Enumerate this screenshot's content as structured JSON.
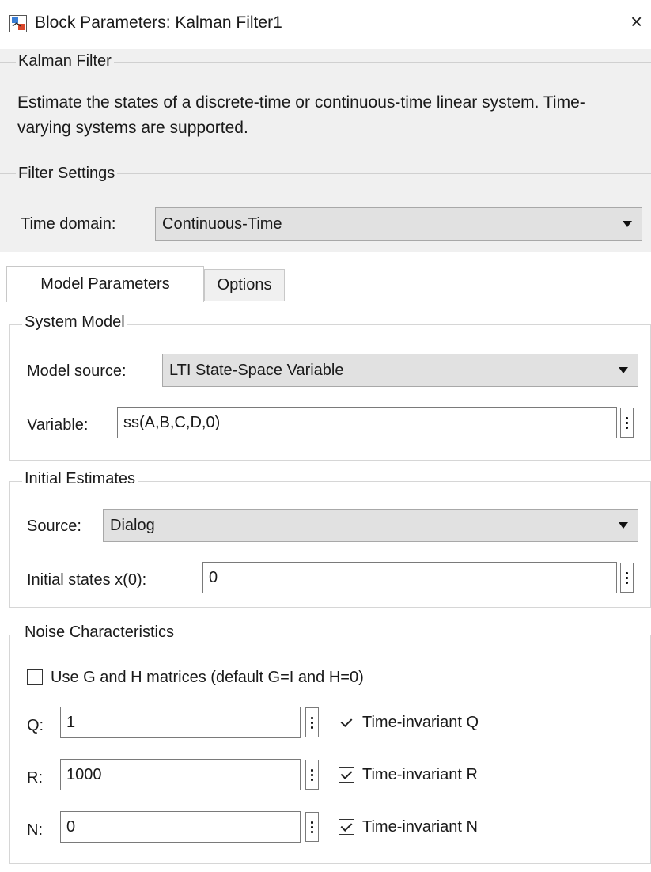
{
  "window": {
    "title": "Block Parameters: Kalman Filter1",
    "close_glyph": "×"
  },
  "block": {
    "name": "Kalman Filter",
    "description": "Estimate the states of a discrete-time or continuous-time linear system. Time-varying systems are supported."
  },
  "filter_settings": {
    "label": "Filter Settings",
    "time_domain_label": "Time domain:",
    "time_domain_value": "Continuous-Time"
  },
  "tabs": [
    {
      "label": "Model Parameters",
      "active": true
    },
    {
      "label": "Options",
      "active": false
    }
  ],
  "system_model": {
    "label": "System Model",
    "model_source_label": "Model source:",
    "model_source_value": "LTI State-Space Variable",
    "variable_label": "Variable:",
    "variable_value": "ss(A,B,C,D,0)"
  },
  "initial_estimates": {
    "label": "Initial Estimates",
    "source_label": "Source:",
    "source_value": "Dialog",
    "initial_states_label": "Initial states x(0):",
    "initial_states_value": "0"
  },
  "noise": {
    "label": "Noise Characteristics",
    "use_gh_label": "Use G and H matrices (default G=I and H=0)",
    "use_gh_checked": false,
    "rows": [
      {
        "label": "Q:",
        "value": "1",
        "ti_label": "Time-invariant Q",
        "checked": true
      },
      {
        "label": "R:",
        "value": "1000",
        "ti_label": "Time-invariant R",
        "checked": true
      },
      {
        "label": "N:",
        "value": "0",
        "ti_label": "Time-invariant N",
        "checked": true
      }
    ]
  },
  "icons": {
    "app": "simulink-block-icon",
    "close": "close-icon",
    "dropdown": "chevron-down-icon",
    "more": "vertical-ellipsis-icon"
  }
}
